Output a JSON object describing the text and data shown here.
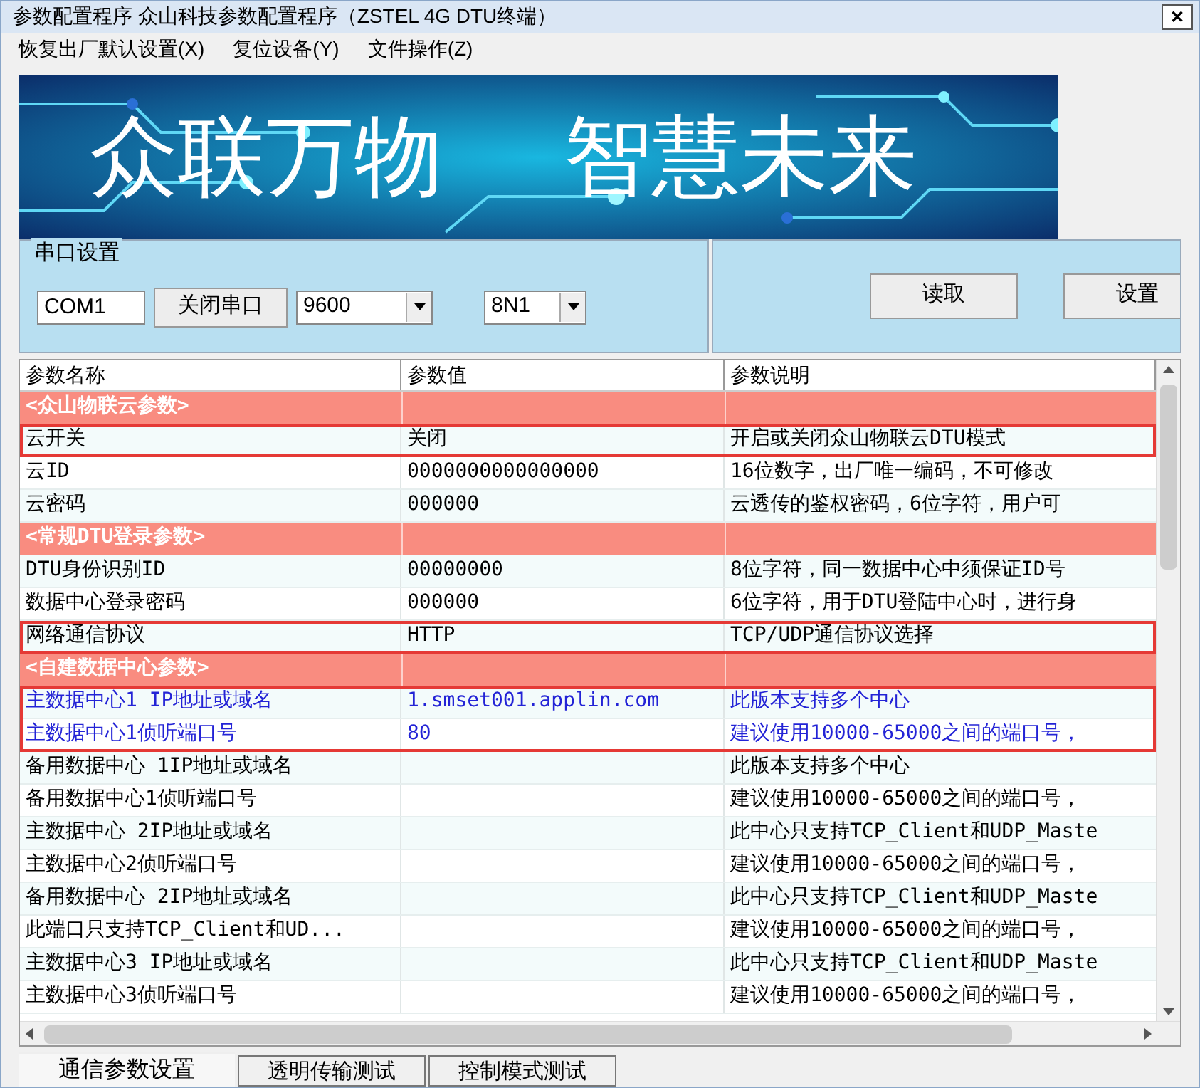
{
  "window": {
    "title": "参数配置程序  众山科技参数配置程序（ZSTEL 4G DTU终端）",
    "close": "✕"
  },
  "menu": [
    "恢复出厂默认设置(X)",
    "复位设备(Y)",
    "文件操作(Z)"
  ],
  "banner": {
    "kind": "picture",
    "slogan_left": "众联万物",
    "slogan_right": "智慧未来"
  },
  "serial": {
    "group_label": "串口设置",
    "port": "COM1",
    "toggle_button": "关闭串口",
    "baud": "9600",
    "format": "8N1"
  },
  "actions": [
    "读取",
    "设置"
  ],
  "table": {
    "columns": [
      "参数名称",
      "参数值",
      "参数说明"
    ],
    "rows": [
      {
        "kind": "group",
        "name": "<众山物联云参数>",
        "boxed": false
      },
      {
        "kind": "param",
        "name": "云开关",
        "value": "关闭",
        "note": "开启或关闭众山物联云DTU模式",
        "boxed": true,
        "changed": false
      },
      {
        "kind": "param",
        "name": "云ID",
        "value": "0000000000000000",
        "note": "16位数字，出厂唯一编码，不可修改",
        "boxed": false,
        "changed": false
      },
      {
        "kind": "param",
        "name": "云密码",
        "value": "000000",
        "note": "云透传的鉴权密码，6位字符，用户可",
        "boxed": false,
        "changed": false
      },
      {
        "kind": "group",
        "name": "<常规DTU登录参数>",
        "boxed": false
      },
      {
        "kind": "param",
        "name": "DTU身份识别ID",
        "value": "00000000",
        "note": "8位字符，同一数据中心中须保证ID号",
        "boxed": false,
        "changed": false
      },
      {
        "kind": "param",
        "name": "数据中心登录密码",
        "value": "000000",
        "note": "6位字符，用于DTU登陆中心时，进行身",
        "boxed": false,
        "changed": false
      },
      {
        "kind": "param",
        "name": "网络通信协议",
        "value": "HTTP",
        "note": "TCP/UDP通信协议选择",
        "boxed": true,
        "changed": false
      },
      {
        "kind": "group",
        "name": "<自建数据中心参数>",
        "boxed": false
      },
      {
        "kind": "param",
        "name": "主数据中心1 IP地址或域名",
        "value": "1.smset001.applin.com",
        "note": "此版本支持多个中心",
        "boxed": true,
        "changed": true
      },
      {
        "kind": "param",
        "name": "主数据中心1侦听端口号",
        "value": "80",
        "note": "建议使用10000-65000之间的端口号，",
        "boxed": true,
        "changed": true
      },
      {
        "kind": "param",
        "name": "备用数据中心 1IP地址或域名",
        "note": "此版本支持多个中心",
        "boxed": false,
        "changed": false
      },
      {
        "kind": "param",
        "name": "备用数据中心1侦听端口号",
        "note": "建议使用10000-65000之间的端口号，",
        "boxed": false,
        "changed": false
      },
      {
        "kind": "param",
        "name": "主数据中心 2IP地址或域名",
        "note": "此中心只支持TCP_Client和UDP_Maste",
        "boxed": false,
        "changed": false
      },
      {
        "kind": "param",
        "name": "主数据中心2侦听端口号",
        "note": "建议使用10000-65000之间的端口号，",
        "boxed": false,
        "changed": false
      },
      {
        "kind": "param",
        "name": "备用数据中心 2IP地址或域名",
        "note": "此中心只支持TCP_Client和UDP_Maste",
        "boxed": false,
        "changed": false
      },
      {
        "kind": "param",
        "name": "此端口只支持TCP_Client和UD...",
        "note": "建议使用10000-65000之间的端口号，",
        "boxed": false,
        "changed": false
      },
      {
        "kind": "param",
        "name": "主数据中心3 IP地址或域名",
        "note": "此中心只支持TCP_Client和UDP_Maste",
        "boxed": false,
        "changed": false
      },
      {
        "kind": "param",
        "name": "主数据中心3侦听端口号",
        "note": "建议使用10000-65000之间的端口号，",
        "boxed": false,
        "changed": false
      }
    ]
  },
  "tabs": [
    {
      "label": "通信参数设置",
      "selected": true
    },
    {
      "label": "透明传输测试",
      "selected": false
    },
    {
      "label": "控制模式测试",
      "selected": false
    }
  ]
}
